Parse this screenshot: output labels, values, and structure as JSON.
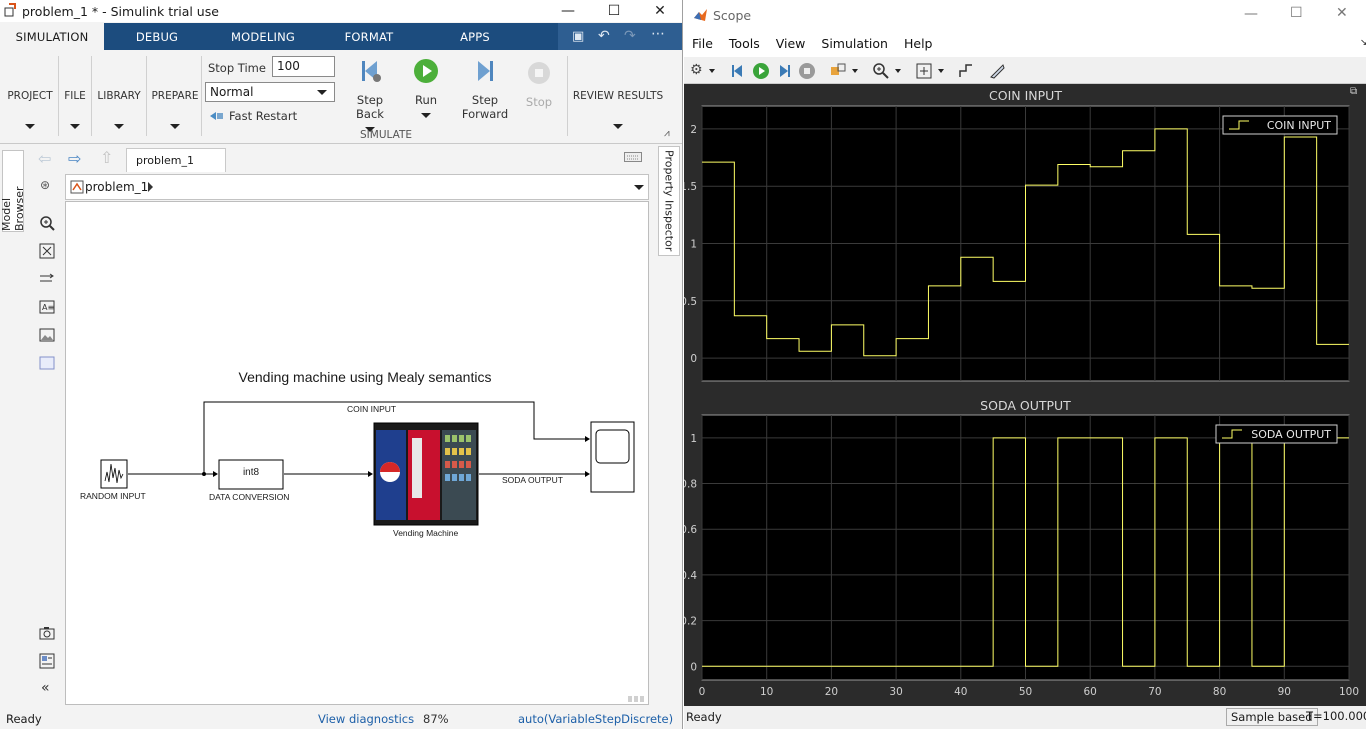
{
  "simulink": {
    "title": "problem_1 * - Simulink trial use",
    "tabs": [
      "SIMULATION",
      "DEBUG",
      "MODELING",
      "FORMAT",
      "APPS"
    ],
    "ribbon": {
      "project": "PROJECT",
      "file": "FILE",
      "library": "LIBRARY",
      "prepare": "PREPARE",
      "stop_time_label": "Stop Time",
      "stop_time_value": "100",
      "mode": "Normal",
      "fast_restart": "Fast Restart",
      "step_back_1": "Step",
      "step_back_2": "Back",
      "run": "Run",
      "step_fwd_1": "Step",
      "step_fwd_2": "Forward",
      "stop": "Stop",
      "simulate": "SIMULATE",
      "review": "REVIEW RESULTS"
    },
    "breadcrumb_tab": "problem_1",
    "address": "problem_1",
    "model_browser": "Model Browser",
    "property_inspector": "Property Inspector",
    "diagram": {
      "heading": "Vending machine using Mealy semantics",
      "coin_signal": "COIN INPUT",
      "soda_signal": "SODA OUTPUT",
      "random_input": "RANDOM INPUT",
      "conversion_block": "int8",
      "data_conversion": "DATA CONVERSION",
      "vending_machine": "Vending Machine"
    },
    "status": {
      "ready": "Ready",
      "diagnostics": "View diagnostics",
      "zoom": "87%",
      "solver": "auto(VariableStepDiscrete)"
    }
  },
  "scope": {
    "title": "Scope",
    "menu": [
      "File",
      "Tools",
      "View",
      "Simulation",
      "Help"
    ],
    "status": {
      "ready": "Ready",
      "sample": "Sample based",
      "time": "T=100.000"
    },
    "colors": {
      "trace": "#ffff66",
      "background": "#000000",
      "grid": "#3a3a3a"
    }
  },
  "chart_data": [
    {
      "type": "line",
      "title": "COIN INPUT",
      "legend": "COIN INPUT",
      "legend_position": "top-right",
      "grid": true,
      "xlim": [
        0,
        100
      ],
      "ylim": [
        -0.2,
        2.2
      ],
      "xticks": [
        0,
        10,
        20,
        30,
        40,
        50,
        60,
        70,
        80,
        90,
        100
      ],
      "yticks": [
        0,
        0.5,
        1,
        1.5,
        2
      ],
      "ytick_labels": [
        "0",
        "0.5",
        "1",
        "1.5",
        "2"
      ],
      "step": true,
      "x": [
        0,
        5,
        10,
        15,
        20,
        25,
        30,
        35,
        40,
        45,
        50,
        55,
        60,
        65,
        70,
        75,
        80,
        85,
        90,
        95,
        100
      ],
      "y": [
        1.71,
        0.37,
        0.17,
        0.06,
        0.29,
        0.02,
        0.17,
        0.63,
        0.88,
        0.67,
        1.51,
        1.69,
        1.67,
        1.81,
        2.0,
        1.08,
        0.63,
        0.61,
        1.93,
        0.12,
        0.12
      ]
    },
    {
      "type": "line",
      "title": "SODA OUTPUT",
      "legend": "SODA OUTPUT",
      "legend_position": "top-right",
      "grid": true,
      "xlim": [
        0,
        100
      ],
      "ylim": [
        -0.06,
        1.1
      ],
      "xticks": [
        0,
        10,
        20,
        30,
        40,
        50,
        60,
        70,
        80,
        90,
        100
      ],
      "xtick_labels": [
        "0",
        "10",
        "20",
        "30",
        "40",
        "50",
        "60",
        "70",
        "80",
        "90",
        "100"
      ],
      "yticks": [
        0,
        0.2,
        0.4,
        0.6,
        0.8,
        1
      ],
      "ytick_labels": [
        "0",
        "0.2",
        "0.4",
        "0.6",
        "0.8",
        "1"
      ],
      "step": true,
      "x": [
        0,
        5,
        10,
        15,
        20,
        25,
        30,
        35,
        40,
        45,
        50,
        55,
        60,
        65,
        70,
        75,
        80,
        85,
        90,
        95,
        100
      ],
      "y": [
        0,
        0,
        0,
        0,
        0,
        0,
        0,
        0,
        0,
        1,
        0,
        1,
        1,
        0,
        1,
        0,
        1,
        0,
        1,
        1,
        1
      ]
    }
  ]
}
